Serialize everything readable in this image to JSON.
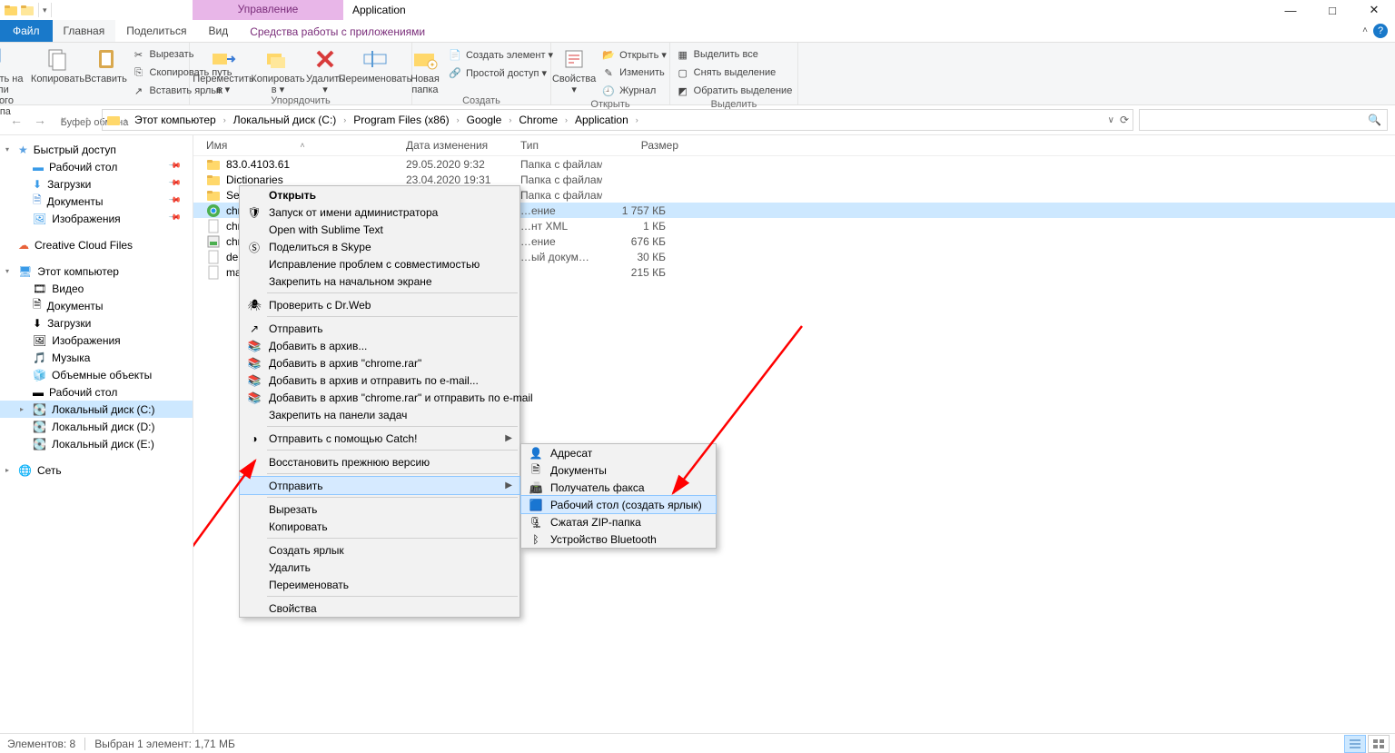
{
  "title_bar": {
    "context_tab": "Управление",
    "app_title": "Application"
  },
  "tabs": {
    "file": "Файл",
    "home": "Главная",
    "share": "Поделиться",
    "view": "Вид",
    "tools": "Средства работы с приложениями"
  },
  "ribbon": {
    "pin": "Закрепить на панели\nбыстрого доступа",
    "copy": "Копировать",
    "paste": "Вставить",
    "cut": "Вырезать",
    "copy_path": "Скопировать путь",
    "paste_shortcut": "Вставить ярлык",
    "group_clipboard": "Буфер обмена",
    "move_to": "Переместить\nв ▾",
    "copy_to": "Копировать\nв ▾",
    "delete": "Удалить\n▾",
    "rename": "Переименовать",
    "group_organize": "Упорядочить",
    "new_folder": "Новая\nпапка",
    "new_item": "Создать элемент ▾",
    "easy_access": "Простой доступ ▾",
    "group_new": "Создать",
    "properties": "Свойства\n▾",
    "open": "Открыть ▾",
    "edit": "Изменить",
    "history": "Журнал",
    "group_open": "Открыть",
    "select_all": "Выделить все",
    "select_none": "Снять выделение",
    "invert": "Обратить выделение",
    "group_select": "Выделить"
  },
  "breadcrumb": {
    "items": [
      "Этот компьютер",
      "Локальный диск (C:)",
      "Program Files (x86)",
      "Google",
      "Chrome",
      "Application"
    ]
  },
  "sidebar": {
    "quick": "Быстрый доступ",
    "desktop": "Рабочий стол",
    "downloads": "Загрузки",
    "documents": "Документы",
    "pictures": "Изображения",
    "ccf": "Creative Cloud Files",
    "this_pc": "Этот компьютер",
    "video": "Видео",
    "documents2": "Документы",
    "downloads2": "Загрузки",
    "pictures2": "Изображения",
    "music": "Музыка",
    "objects3d": "Объемные объекты",
    "desktop2": "Рабочий стол",
    "disk_c": "Локальный диск (C:)",
    "disk_d": "Локальный диск (D:)",
    "disk_e": "Локальный диск (E:)",
    "network": "Сеть"
  },
  "columns": {
    "name": "Имя",
    "date": "Дата изменения",
    "type": "Тип",
    "size": "Размер"
  },
  "files": [
    {
      "icon": "folder",
      "name": "83.0.4103.61",
      "date": "29.05.2020 9:32",
      "type": "Папка с файлами",
      "size": ""
    },
    {
      "icon": "folder",
      "name": "Dictionaries",
      "date": "23.04.2020 19:31",
      "type": "Папка с файлами",
      "size": ""
    },
    {
      "icon": "folder",
      "name": "SetupMetrics",
      "date": "29.05.2020 9:32",
      "type": "Папка с файлами",
      "size": ""
    },
    {
      "icon": "chrome",
      "name": "chrome",
      "date": "",
      "type": "…ение",
      "size": "1 757 КБ",
      "sel": true
    },
    {
      "icon": "file",
      "name": "chro…",
      "date": "",
      "type": "…нт XML",
      "size": "1 КБ"
    },
    {
      "icon": "exe",
      "name": "chro…",
      "date": "",
      "type": "…ение",
      "size": "676 КБ"
    },
    {
      "icon": "file",
      "name": "debu…",
      "date": "",
      "type": "…ый докум…",
      "size": "30 КБ"
    },
    {
      "icon": "file",
      "name": "mast…",
      "date": "",
      "type": "",
      "size": "215 КБ"
    }
  ],
  "context_menu": [
    {
      "t": "Открыть",
      "bold": true
    },
    {
      "t": "Запуск от имени администратора",
      "icon": "shield"
    },
    {
      "t": "Open with Sublime Text"
    },
    {
      "t": "Поделиться в Skype",
      "icon": "skype"
    },
    {
      "t": "Исправление проблем с совместимостью"
    },
    {
      "t": "Закрепить на начальном экране"
    },
    {
      "sep": true
    },
    {
      "t": "Проверить с Dr.Web",
      "icon": "drweb"
    },
    {
      "sep": true
    },
    {
      "t": "Отправить",
      "icon": "share"
    },
    {
      "t": "Добавить в архив...",
      "icon": "rar"
    },
    {
      "t": "Добавить в архив \"chrome.rar\"",
      "icon": "rar"
    },
    {
      "t": "Добавить в архив и отправить по e-mail...",
      "icon": "rar"
    },
    {
      "t": "Добавить в архив \"chrome.rar\" и отправить по e-mail",
      "icon": "rar"
    },
    {
      "t": "Закрепить на панели задач"
    },
    {
      "sep": true
    },
    {
      "t": "Отправить с помощью Catch!",
      "icon": "catch",
      "arrow": true
    },
    {
      "sep": true
    },
    {
      "t": "Восстановить прежнюю версию"
    },
    {
      "sep": true
    },
    {
      "t": "Отправить",
      "arrow": true,
      "hover": true
    },
    {
      "sep": true
    },
    {
      "t": "Вырезать"
    },
    {
      "t": "Копировать"
    },
    {
      "sep": true
    },
    {
      "t": "Создать ярлык"
    },
    {
      "t": "Удалить"
    },
    {
      "t": "Переименовать"
    },
    {
      "sep": true
    },
    {
      "t": "Свойства"
    }
  ],
  "submenu": [
    {
      "t": "Адресат",
      "icon": "contact"
    },
    {
      "t": "Документы",
      "icon": "docs"
    },
    {
      "t": "Получатель факса",
      "icon": "fax"
    },
    {
      "t": "Рабочий стол (создать ярлык)",
      "icon": "desk",
      "hover": true
    },
    {
      "t": "Сжатая ZIP-папка",
      "icon": "zip"
    },
    {
      "t": "Устройство Bluetooth",
      "icon": "bt"
    }
  ],
  "status": {
    "count": "Элементов: 8",
    "sel": "Выбран 1 элемент: 1,71 МБ"
  }
}
